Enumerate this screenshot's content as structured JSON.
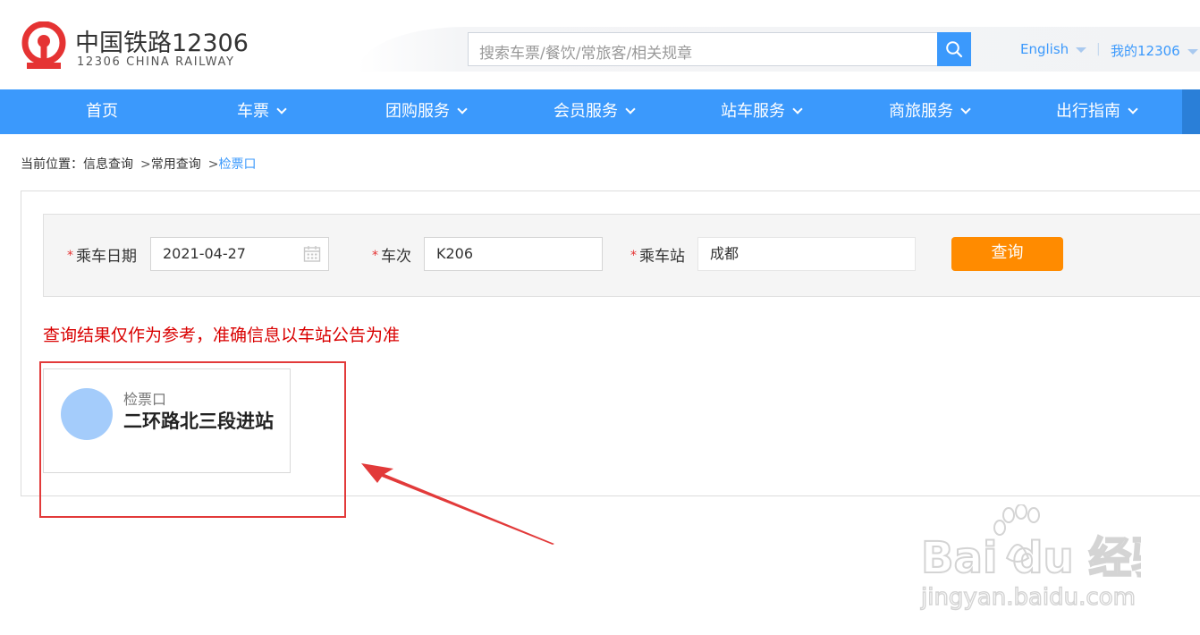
{
  "brand": {
    "title": "中国铁路12306",
    "subtitle": "12306 CHINA RAILWAY",
    "color": "#e53333"
  },
  "search": {
    "placeholder": "搜索车票/餐饮/常旅客/相关规章"
  },
  "header_links": {
    "language": "English",
    "separator": "|",
    "account": "我的12306"
  },
  "nav": {
    "items": [
      {
        "label": "首页",
        "has_dropdown": false
      },
      {
        "label": "车票",
        "has_dropdown": true
      },
      {
        "label": "团购服务",
        "has_dropdown": true
      },
      {
        "label": "会员服务",
        "has_dropdown": true
      },
      {
        "label": "站车服务",
        "has_dropdown": true
      },
      {
        "label": "商旅服务",
        "has_dropdown": true
      },
      {
        "label": "出行指南",
        "has_dropdown": true
      }
    ],
    "color": "#3b99fc"
  },
  "breadcrumb": {
    "prefix": "当前位置：",
    "items": [
      "信息查询",
      "常用查询",
      "检票口"
    ],
    "separator": ">"
  },
  "form": {
    "required_mark": "*",
    "date_label": "乘车日期",
    "date_value": "2021-04-27",
    "train_label": "车次",
    "train_value": "K206",
    "station_label": "乘车站",
    "station_value": "成都",
    "query_button": "查询",
    "query_button_color": "#ff8b00"
  },
  "notice": "查询结果仅作为参考，准确信息以车站公告为准",
  "result": {
    "label": "检票口",
    "value": "二环路北三段进站"
  },
  "watermark": {
    "brand": "Bai du 经验",
    "url": "jingyan.baidu.com"
  },
  "annotation_color": "#e23a3a"
}
